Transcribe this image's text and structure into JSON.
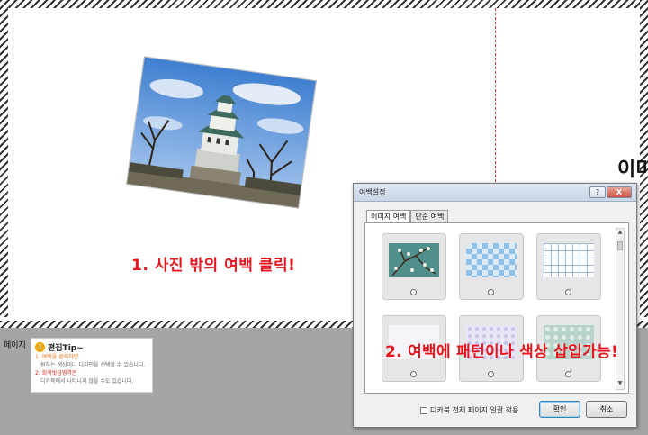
{
  "canvas": {
    "annotation_1": "1. 사진 밖의 여백 클릭!",
    "side_text": "이미"
  },
  "bottom_panel": {
    "page_label": "페이지",
    "tip": {
      "title": "편집Tip~",
      "items": [
        {
          "heading": "1. 여백을 클릭하면",
          "detail": "원하는 색상이나 디자인을 선택할 수 있습니다."
        },
        {
          "heading": "2. 회색빗금영역은",
          "detail": "디카북에서 나타나지 않을 수도 있습니다."
        }
      ]
    }
  },
  "dialog": {
    "title": "여백설정",
    "help_label": "?",
    "close_label": "X",
    "tabs": [
      {
        "label": "이미지 여백",
        "active": true
      },
      {
        "label": "단순 여백",
        "active": false
      }
    ],
    "patterns": [
      {
        "name": "almond-blossom"
      },
      {
        "name": "blue-checker"
      },
      {
        "name": "blue-grid"
      },
      {
        "name": "floral-white"
      },
      {
        "name": "lavender-dots"
      },
      {
        "name": "mint-pattern"
      }
    ],
    "apply_all_label": "디카북 전체 페이지 일괄 적용",
    "ok_label": "확인",
    "cancel_label": "취소",
    "annotation_2": "2. 여백에 패턴이나 색상 삽입가능!"
  },
  "colors": {
    "annotation_red": "#e8141c",
    "bottom_panel_grey": "#a5a5a5",
    "guide_line": "#e03030"
  }
}
